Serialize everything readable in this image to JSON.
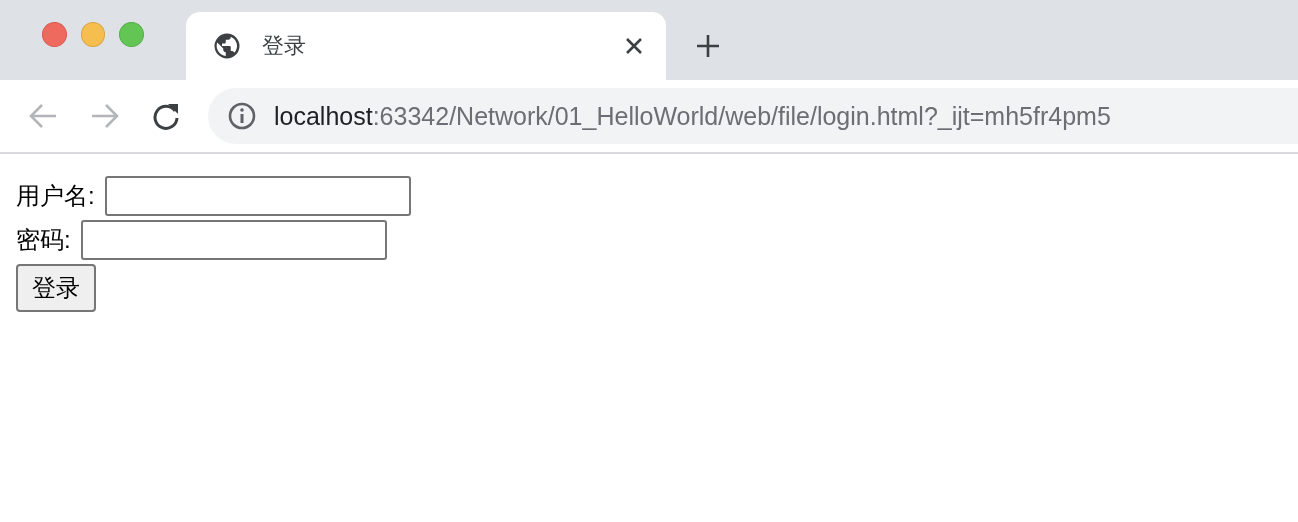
{
  "tab": {
    "title": "登录",
    "selected": true
  },
  "address_bar": {
    "host": "localhost",
    "rest": ":63342/Network/01_HelloWorld/web/file/login.html?_ijt=mh5fr4pm5"
  },
  "form": {
    "fields": [
      {
        "label": "用户名:"
      },
      {
        "label": "密码:"
      }
    ],
    "submit": "登录"
  }
}
